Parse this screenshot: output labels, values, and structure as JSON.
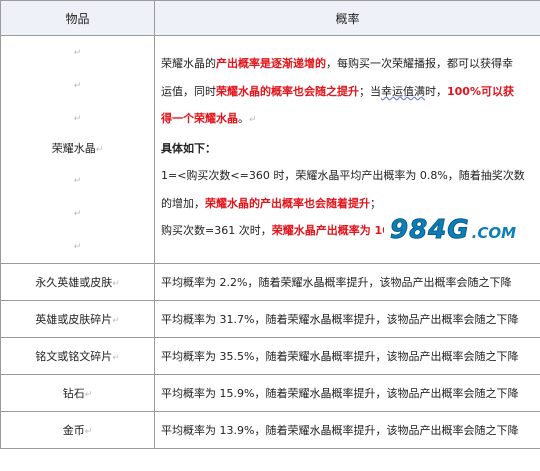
{
  "header": {
    "item": "物品",
    "rate": "概率"
  },
  "mark": "↵",
  "crystal": {
    "name": "荣耀水晶",
    "p1_a": "荣耀水晶的",
    "p1_b": "产出概率是逐渐递增的",
    "p1_c": "，每购买一次荣耀播报，都可以获得幸",
    "p1_d": "运值，同时",
    "p1_e": "荣耀水晶的概率也会随之提升",
    "p1_f": "；当",
    "p1_g": "幸运值满",
    "p1_h": "时，",
    "p1_i": "100%可以获",
    "p1_j": "得一个荣耀水晶",
    "p1_k": "。",
    "p2": "具体如下：",
    "p3": "1=<购买次数<=360 时，荣耀水晶平均产出概率为 0.8%，随着抽奖次数",
    "p4_a": "的增加，",
    "p4_b": "荣耀水晶的产出概率也会随着提升",
    "p4_c": "；",
    "p5_a": "购买次数=361 次时，",
    "p5_b": "荣耀水晶产出概率为 100%",
    "p5_c": "。"
  },
  "rows": [
    {
      "name": "永久英雄或皮肤",
      "text": "平均概率为 2.2%，随着荣耀水晶概率提升，该物品产出概率会随之下降"
    },
    {
      "name": "英雄或皮肤碎片",
      "text": "平均概率为 31.7%，随着荣耀水晶概率提升，该物品产出概率会随之下降"
    },
    {
      "name": "铭文或铭文碎片",
      "text": "平均概率为 35.5%，随着荣耀水晶概率提升，该物品产出概率会随之下降"
    },
    {
      "name": "钻石",
      "text": "平均概率为 15.9%，随着荣耀水晶概率提升，该物品产出概率会随之下降"
    },
    {
      "name": "金币",
      "text": "平均概率为 13.9%，随着荣耀水晶概率提升，该物品产出概率会随之下降"
    }
  ],
  "watermark": {
    "main": "984G",
    "sub": ".COM"
  }
}
